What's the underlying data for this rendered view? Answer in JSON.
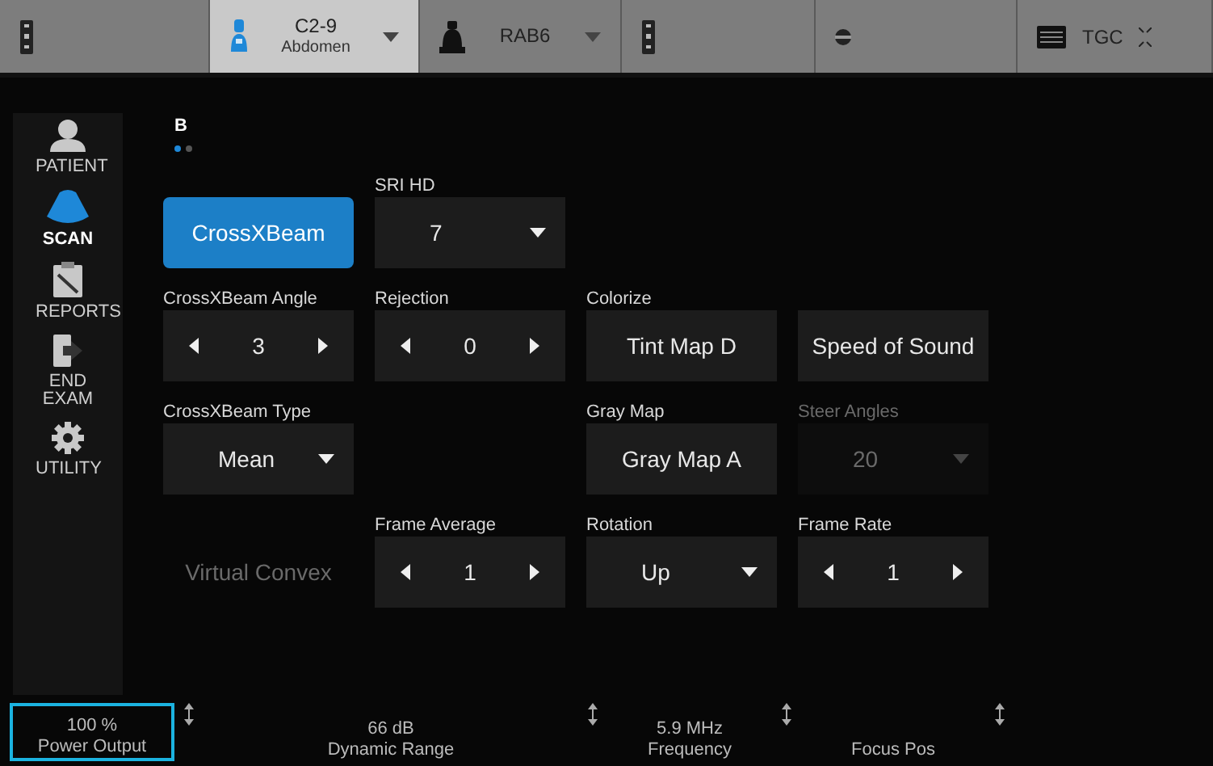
{
  "top_bar": [
    {
      "kind": "remote",
      "selected": false
    },
    {
      "kind": "probe",
      "label": "C2-9",
      "sublabel": "Abdomen",
      "selected": true
    },
    {
      "kind": "probe",
      "label": "RAB6",
      "selected": false
    },
    {
      "kind": "remote",
      "selected": false
    },
    {
      "kind": "knob",
      "selected": false
    },
    {
      "kind": "tgc",
      "label": "TGC",
      "selected": false
    }
  ],
  "sidebar": [
    {
      "kind": "patient",
      "label": "PATIENT",
      "selected": false
    },
    {
      "kind": "scan",
      "label": "SCAN",
      "selected": true
    },
    {
      "kind": "reports",
      "label": "REPORTS",
      "selected": false
    },
    {
      "kind": "end",
      "label": "END EXAM",
      "selected": false
    },
    {
      "kind": "utility",
      "label": "UTILITY",
      "selected": false
    }
  ],
  "mode": {
    "label": "B",
    "pages": [
      {
        "selected": true
      },
      {
        "selected": false
      }
    ]
  },
  "grid": [
    {
      "left": [
        {
          "kind": "toggle",
          "value": "CrossXBeam",
          "selected": true,
          "disabled": false
        },
        {
          "kind": "dropdown",
          "title": "SRI HD",
          "value": "7",
          "disabled": false
        }
      ]
    },
    {
      "left": [
        {
          "kind": "stepper",
          "title": "CrossXBeam Angle",
          "value": "3",
          "disabled": false
        },
        {
          "kind": "stepper",
          "title": "Rejection",
          "value": "0",
          "disabled": false
        }
      ],
      "right": [
        {
          "kind": "button",
          "title": "Colorize",
          "value": "Tint Map D",
          "disabled": false
        },
        {
          "kind": "button",
          "value": "Speed of Sound",
          "disabled": false
        }
      ]
    },
    {
      "left": [
        {
          "kind": "dropdown",
          "title": "CrossXBeam Type",
          "value": "Mean",
          "disabled": false
        }
      ],
      "right": [
        {
          "kind": "button",
          "title": "Gray Map",
          "value": "Gray Map A",
          "disabled": false
        },
        {
          "kind": "dropdown",
          "title": "Steer Angles",
          "value": "20",
          "disabled": true
        }
      ]
    },
    {
      "left": [
        {
          "kind": "toggle",
          "value": "Virtual Convex",
          "selected": false,
          "disabled": true
        },
        {
          "kind": "stepper",
          "title": "Frame Average",
          "value": "1",
          "disabled": false
        }
      ],
      "right": [
        {
          "kind": "dropdown",
          "title": "Rotation",
          "value": "Up",
          "disabled": false
        },
        {
          "kind": "stepper",
          "title": "Frame Rate",
          "value": "1",
          "disabled": false
        }
      ]
    }
  ],
  "bottom_bar": [
    {
      "value": "100 %",
      "label": "Power Output",
      "selected": true
    },
    {
      "value": "66 dB",
      "label": "Dynamic Range",
      "selected": false
    },
    {
      "value": "5.9 MHz",
      "label": "Frequency",
      "selected": false
    },
    {
      "label": "Focus Pos",
      "selected": false
    }
  ]
}
